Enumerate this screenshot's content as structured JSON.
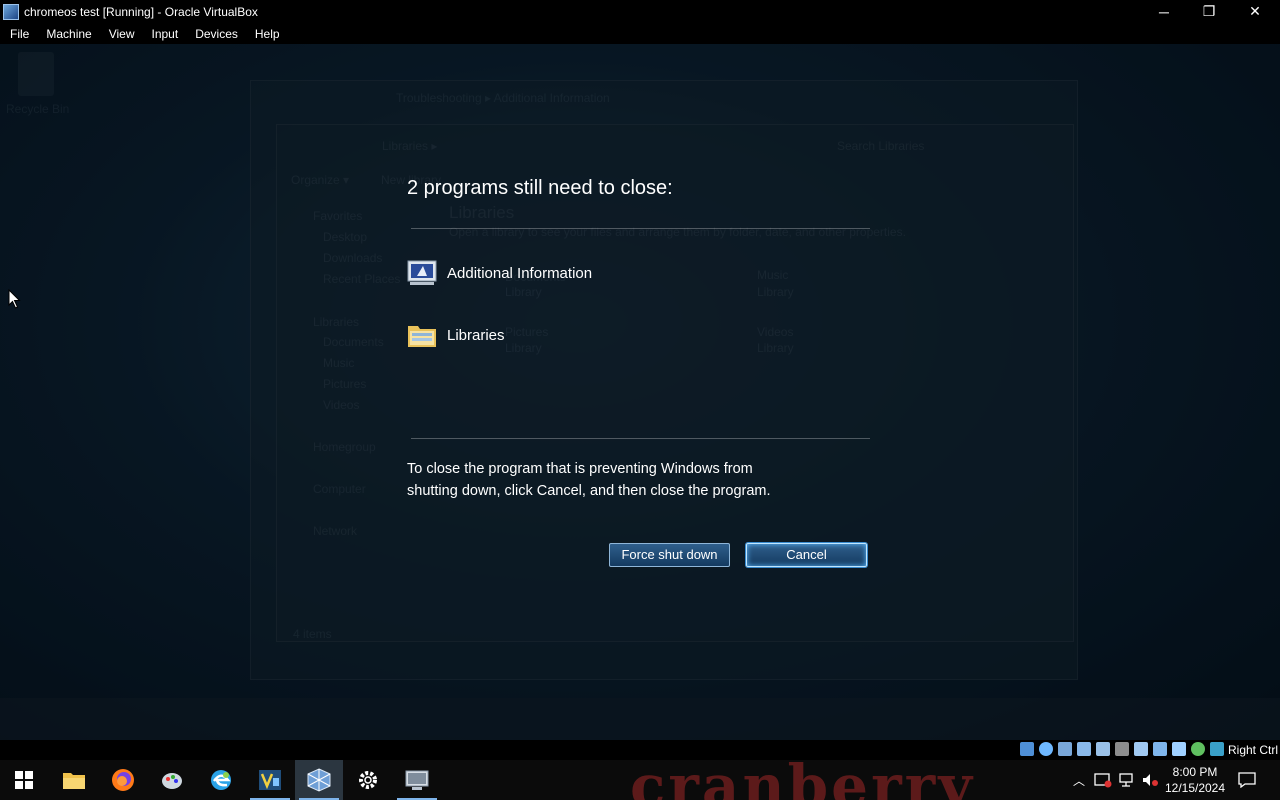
{
  "host": {
    "title": "chromeos test [Running] - Oracle VirtualBox",
    "controls": {
      "minimize": "─",
      "restore": "❐",
      "close": "✕"
    },
    "menu": [
      "File",
      "Machine",
      "View",
      "Input",
      "Devices",
      "Help"
    ],
    "status_right_label": "Right Ctrl"
  },
  "guest": {
    "background": {
      "desktop_icon_label": "Recycle Bin",
      "explorer_back": {
        "breadcrumb": "Troubleshooting ▸ Additional Information"
      },
      "explorer_front": {
        "breadcrumb": "Libraries ▸",
        "search_placeholder": "Search Libraries",
        "toolbar": [
          "Organize ▾",
          "New library"
        ],
        "heading": "Libraries",
        "subheading": "Open a library to see your files and arrange them by folder, date, and other properties.",
        "nav": [
          "Favorites",
          "Desktop",
          "Downloads",
          "Recent Places",
          "Libraries",
          "Documents",
          "Music",
          "Pictures",
          "Videos",
          "Homegroup",
          "Computer",
          "Network"
        ],
        "items": [
          "Documents",
          "Library",
          "Music",
          "Library",
          "Pictures",
          "Library",
          "Videos",
          "Library"
        ],
        "status": "4 items"
      }
    },
    "dialog": {
      "title": "2 programs still need to close:",
      "programs": [
        {
          "name": "Additional Information",
          "icon": "monitor-icon"
        },
        {
          "name": "Libraries",
          "icon": "folder-icon"
        }
      ],
      "explanation": "To close the program that is preventing Windows from shutting down, click Cancel, and then close the program.",
      "force_label": "Force shut down",
      "cancel_label": "Cancel"
    }
  },
  "taskbar": {
    "watermark": "cranberry",
    "apps": [
      {
        "icon": "windows-start-icon"
      },
      {
        "icon": "file-explorer-icon"
      },
      {
        "icon": "firefox-icon"
      },
      {
        "icon": "paint-icon"
      },
      {
        "icon": "edge-legacy-icon"
      },
      {
        "icon": "visual-studio-icon"
      },
      {
        "icon": "virtualbox-icon"
      },
      {
        "icon": "settings-gear-icon"
      },
      {
        "icon": "virtual-machine-icon"
      }
    ],
    "clock_time": "8:00 PM",
    "clock_date": "12/15/2024"
  },
  "colors": {
    "dialog_button_top": "#2f5f8c",
    "dialog_button_bottom": "#143a60",
    "desktop": "#0c2336"
  }
}
